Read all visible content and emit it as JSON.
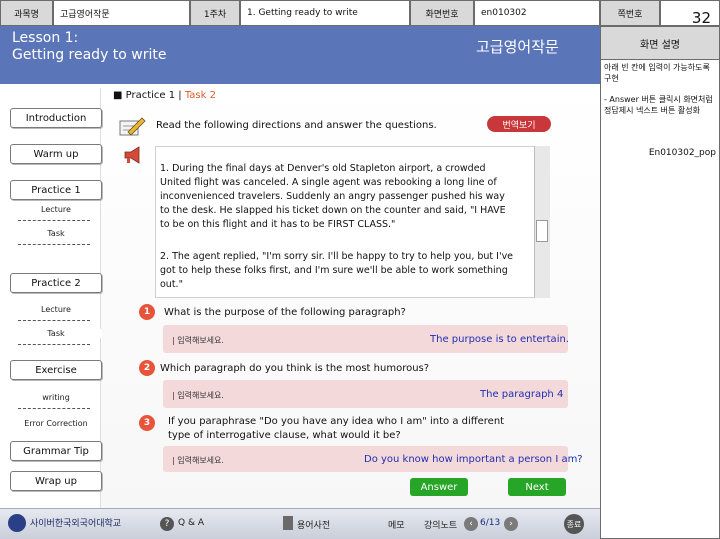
{
  "header": {
    "course_label": "과목명",
    "course_value": "고급영어작문",
    "week_label": "1주차",
    "week_value": "1. Getting ready to write",
    "screen_no_label": "화면번호",
    "screen_no_value": "en010302",
    "page_no_label": "쪽번호",
    "page_no_value": "32"
  },
  "lesson": {
    "line1": "Lesson 1:",
    "line2": "Getting ready to write",
    "course_title": "고급영어작문"
  },
  "sidebar": {
    "introduction": "Introduction",
    "warmup": "Warm up",
    "practice1": "Practice 1",
    "practice1_lecture": "Lecture",
    "practice1_task": "Task",
    "practice2": "Practice 2",
    "practice2_lecture": "Lecture",
    "practice2_task": "Task",
    "exercise": "Exercise",
    "writing": "writing",
    "error_correction": "Error Correction",
    "grammar_tip": "Grammar Tip",
    "wrapup": "Wrap up"
  },
  "main": {
    "section_title": "■ Practice 1  |  ",
    "section_task": "Task 2",
    "directions": "Read the following directions and answer the questions.",
    "translate_button": "번역보기",
    "paragraph1": "1. During the final days at Denver's old Stapleton airport, a crowded United flight was canceled. A single agent was rebooking a long line of inconvenienced travelers. Suddenly an angry passenger pushed his way to the desk. He slapped his ticket down on the counter and said, \"I HAVE to be on this flight and it has to be FIRST CLASS.\"",
    "paragraph2": "2. The agent replied, \"I'm sorry sir. I'll be happy to try to help you, but I've got to help these folks first, and I'm sure we'll be able to work something out.\"",
    "questions": [
      {
        "num": "1",
        "text": "What is the purpose of the following paragraph?",
        "placeholder": "| 입력해보세요.",
        "answer": "The purpose is to entertain."
      },
      {
        "num": "2",
        "text": "Which paragraph do you think is the most humorous?",
        "placeholder": "| 입력해보세요.",
        "answer": "The paragraph 4"
      },
      {
        "num": "3",
        "text": "If you paraphrase \"Do you have any idea who I am\" into a different type of interrogative clause, what would it be?",
        "placeholder": "| 입력해보세요.",
        "answer": "Do you know how important a person I am?"
      }
    ],
    "answer_button": "Answer",
    "next_button": "Next"
  },
  "footer": {
    "university": "사이버한국외국어대학교",
    "qa": "Q & A",
    "glossary": "용어사전",
    "memo": "메모",
    "lecture_note": "강의노트",
    "page_indicator": "6/13",
    "end": "종료"
  },
  "right_panel": {
    "heading": "화면 설명",
    "note1": "아래 빈 칸에 입력이 가능하도록 구현",
    "note2": "- Answer 버튼 클릭시 화면처럼 정답제시 넥스트 버튼 활성화",
    "note3": "En010302_pop"
  },
  "colors": {
    "title_band": "#5b76b8",
    "answer_bg": "#f4d9db",
    "answer_text": "#1f2fb2",
    "number_badge": "#e8543a",
    "nav_green": "#27a527",
    "translate_red": "#c8383a"
  }
}
